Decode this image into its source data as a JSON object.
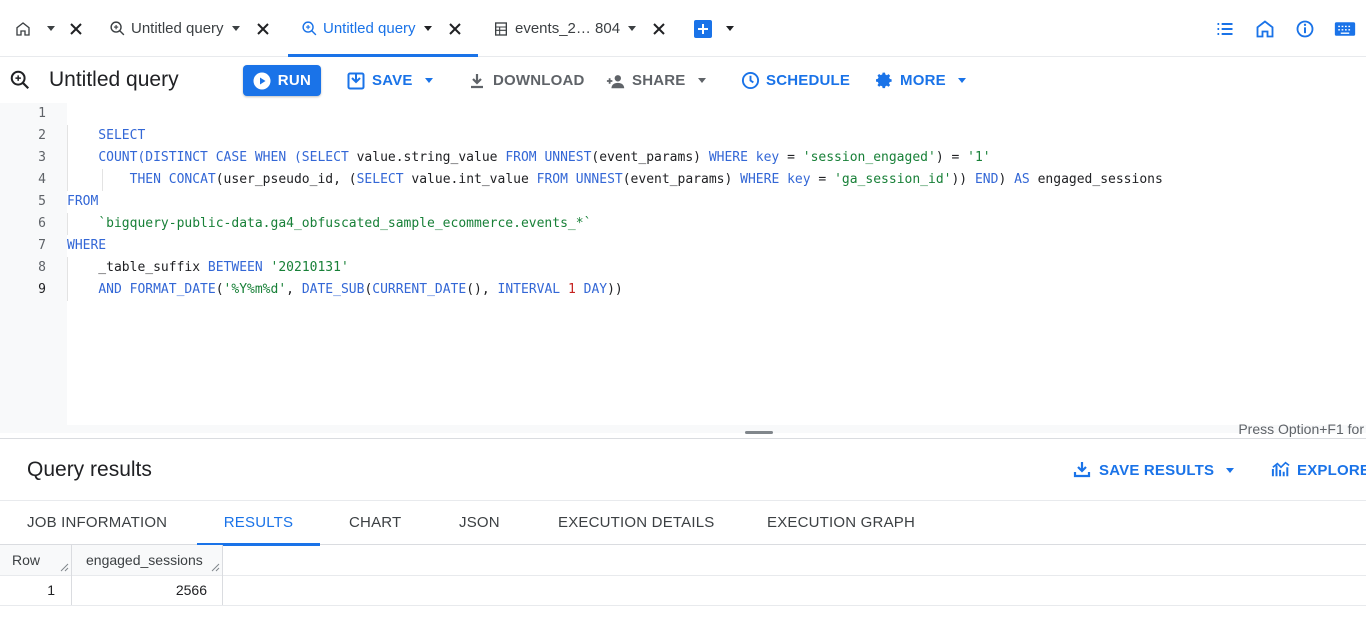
{
  "tabs": [
    {
      "label": "",
      "type": "home"
    },
    {
      "label": "Untitled query",
      "type": "query",
      "active": false
    },
    {
      "label": "Untitled query",
      "type": "query",
      "active": true
    },
    {
      "label": "events_2… 804",
      "type": "table",
      "active": false
    }
  ],
  "toolbar": {
    "title": "Untitled query",
    "run_label": "RUN",
    "save_label": "SAVE",
    "download_label": "DOWNLOAD",
    "share_label": "SHARE",
    "schedule_label": "SCHEDULE",
    "more_label": "MORE"
  },
  "editor": {
    "line_numbers": [
      "1",
      "2",
      "3",
      "4",
      "5",
      "6",
      "7",
      "8",
      "9"
    ],
    "hint": "Press Option+F1 for"
  },
  "results": {
    "title": "Query results",
    "save_results_label": "SAVE RESULTS",
    "explore_label": "EXPLORE",
    "tabs": [
      "JOB INFORMATION",
      "RESULTS",
      "CHART",
      "JSON",
      "EXECUTION DETAILS",
      "EXECUTION GRAPH"
    ],
    "active_tab": "RESULTS",
    "columns": [
      "Row",
      "engaged_sessions"
    ],
    "rows": [
      [
        "1",
        "2566"
      ]
    ]
  },
  "colors": {
    "accent": "#1a73e8",
    "keyword": "#3367d6",
    "string": "#188038",
    "number": "#c5221f"
  }
}
